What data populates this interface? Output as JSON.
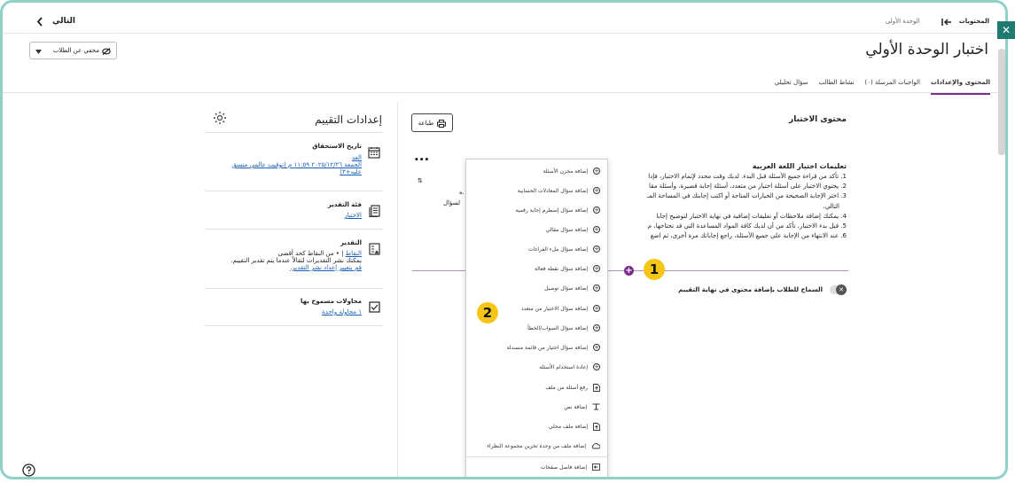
{
  "topbar": {
    "next_label": "التالي",
    "breadcrumb_root": "المحتويات",
    "breadcrumb_current": "الوحدة الأولى"
  },
  "header": {
    "visibility_label": "مخفي عن الطلاب",
    "page_title": "اختبار الوحدة الأولي"
  },
  "tabs": [
    {
      "label": "المحتوى والإعدادات",
      "active": true
    },
    {
      "label": "الواجبات المرسلة (٠)",
      "active": false
    },
    {
      "label": "نشاط الطالب",
      "active": false
    },
    {
      "label": "سؤال تحليلي",
      "active": false
    }
  ],
  "content": {
    "print_label": "طباعة",
    "section_title": "محتوى الاختبار",
    "instructions_title": "تعليمات اختبار اللغة العربية",
    "instructions": [
      "1. تأكد من قراءة جميع الأسئلة قبل البدء. لديك وقت محدد لإتمام الاختبار، فإدا",
      "2. يحتوي الاختبار على أسئلة اختيار من متعدد، أسئلة إجابة قصيرة، وأسئلة مقا",
      "3. اختر الإجابة الصحيحة من الخيارات المتاحة أو اكتب إجابتك في المساحة المـ",
      "التالي.",
      "4. يمكنك إضافة ملاحظات أو تعليقات إضافية في نهاية الاختبار لتوضيح إجابا",
      "5. قبل بدء الاختبار، تأكد من أن لديك كافة المواد المساعدة التي قد تحتاجها، م",
      "6. عند الانتهاء من الإجابة على جميع الأسئلة، راجع إجاباتك مرة أخرى، ثم اضغ"
    ],
    "partial_left_1": "ه.",
    "partial_left_2": "لسؤال",
    "toggle_label": "السماح للطلاب بإضافة محتوى في نهاية التقييم"
  },
  "menu": {
    "items": [
      {
        "label": "إضافة مخزن الأسئلة",
        "icon": "plus-circle-icon"
      },
      {
        "label": "إضافة سؤال المعادلات الحسابية",
        "icon": "plus-circle-icon"
      },
      {
        "label": "إضافة سؤال إسطرم إجابة رقمية",
        "icon": "plus-circle-icon"
      },
      {
        "label": "إضافة سؤال مقالي",
        "icon": "plus-circle-icon"
      },
      {
        "label": "إضافة سؤال ملء الفراغات",
        "icon": "plus-circle-icon"
      },
      {
        "label": "إضافة سؤال نقطة فعالة",
        "icon": "plus-circle-icon"
      },
      {
        "label": "إضافة سؤال توصيل",
        "icon": "plus-circle-icon"
      },
      {
        "label": "إضافة سؤال الاختيار من متعدد",
        "icon": "plus-circle-icon"
      },
      {
        "label": "إضافة سؤال الصواب/الخطأ",
        "icon": "plus-circle-icon"
      },
      {
        "label": "إضافة سؤال اختيار من قائمة منسدلة",
        "icon": "plus-circle-icon"
      },
      {
        "label": "إعادة استخدام الأسئلة",
        "icon": "plus-circle-icon"
      },
      {
        "label": "رفع أسئلة من ملف",
        "icon": "upload-icon"
      },
      {
        "label": "إضافة نص",
        "icon": "text-icon"
      },
      {
        "label": "إضافة ملف محلي",
        "icon": "file-upload-icon"
      },
      {
        "label": "إضافة ملف من وحدة تخزين مجموعة النظراء",
        "icon": "cloud-icon"
      },
      {
        "label": "إضافة فاصل صفحات",
        "icon": "page-break-icon"
      }
    ]
  },
  "callouts": {
    "one": "1",
    "two": "2"
  },
  "settings": {
    "title": "إعدادات التقييم",
    "due_title": "تاريخ الاستحقاق",
    "due_line1": "الغد",
    "due_line2": "الجمعة ٢٠٢٥/١٢/٢٦ ١١:٥٩ م (توقيت عالمي منسق",
    "due_line3": "عليه+٣)",
    "category_title": "فئة التقدير",
    "category_value": "الاختبار",
    "grading_title": "التقدير",
    "grading_line1_link": "النقاط",
    "grading_line1_rest": " | • من النقاط كحد أقصى",
    "grading_line2": "يمكنك نشر التقديرات لتقالاً عندما يتم تقدير التقييم.",
    "grading_line3": "قم بتغيير إعداد نشر التقدير.",
    "attempts_title": "محاولات مسموح بها",
    "attempts_value": "١ محاولة واحدة"
  },
  "colors": {
    "accent": "#7b2d8e",
    "callout": "#f5c518",
    "frame": "#8fd0c8",
    "close_bg": "#1f7a70"
  }
}
